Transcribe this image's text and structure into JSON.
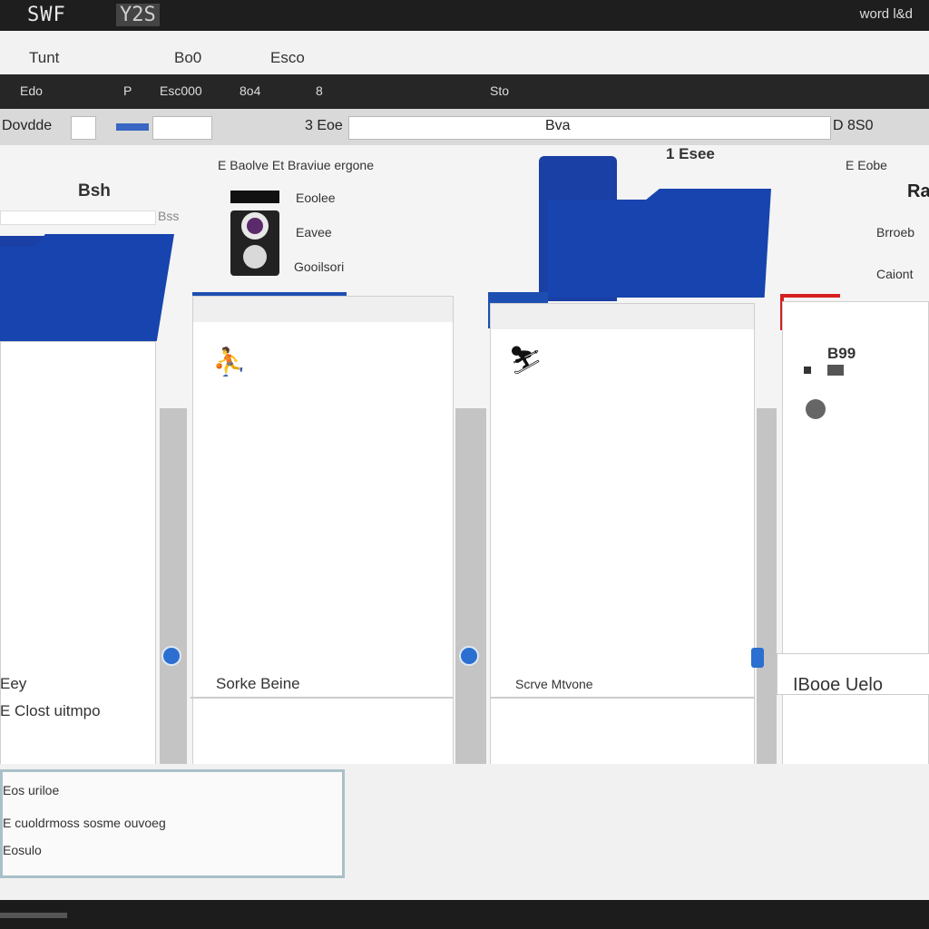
{
  "window": {
    "title_a": "SWF",
    "title_b": "Y2S",
    "account": "word l&d"
  },
  "menu": {
    "items": [
      "Tunt",
      "Bo0",
      "Esco"
    ]
  },
  "toolbar": {
    "items": [
      "Edo",
      "P",
      "Esc000",
      "8o4",
      "8",
      "Sto"
    ]
  },
  "address": {
    "left": "Dovdde",
    "mid": "3 Eoe",
    "right": "Bva",
    "far": "D 8S0"
  },
  "details": {
    "heading": "E Baolve Et Braviue ergone",
    "rows": [
      "Eoolee",
      "Eavee",
      "Gooilsori"
    ]
  },
  "folders": [
    {
      "label": "Bsh",
      "sublabel": "Bss"
    },
    {
      "label": "1 Esee",
      "sublabel": ""
    }
  ],
  "right_panel": {
    "title": "E Eobe",
    "sub": "Ra",
    "row1": "Brroeb",
    "row2": "Caiont",
    "num": "B99"
  },
  "captions": [
    "Eey",
    "E Clost uitmpo",
    "Sorke Beine",
    "Scrve Mtvone",
    "IBooe Uelo"
  ],
  "info": {
    "line1": "Eos uriloe",
    "line2": "E cuoldrmoss sosme ouvoeg",
    "line3": "Eosulo"
  }
}
